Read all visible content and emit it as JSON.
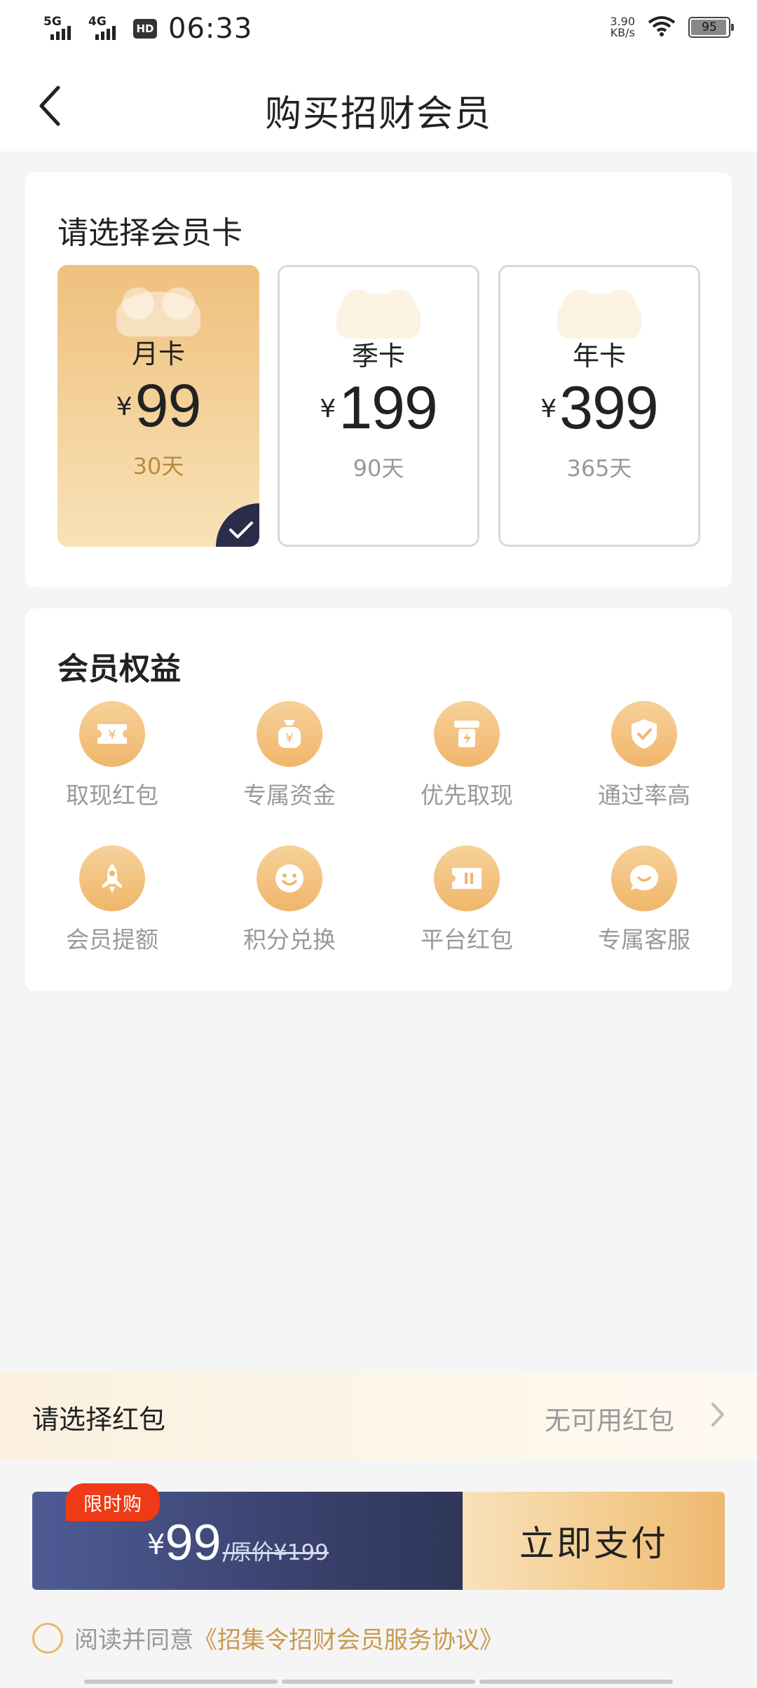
{
  "status_bar": {
    "network1": "5G",
    "network2": "4G",
    "hd": "HD",
    "time": "06:33",
    "speed_value": "3.90",
    "speed_unit": "KB/s",
    "battery": "95"
  },
  "header": {
    "title": "购买招财会员"
  },
  "plans": {
    "section_title": "请选择会员卡",
    "currency": "¥",
    "items": [
      {
        "name": "月卡",
        "price": "99",
        "days": "30天",
        "selected": true
      },
      {
        "name": "季卡",
        "price": "199",
        "days": "90天",
        "selected": false
      },
      {
        "name": "年卡",
        "price": "399",
        "days": "365天",
        "selected": false
      }
    ]
  },
  "benefits": {
    "section_title": "会员权益",
    "items": [
      {
        "label": "取现红包",
        "icon": "ticket-yen-icon"
      },
      {
        "label": "专属资金",
        "icon": "money-bag-icon"
      },
      {
        "label": "优先取现",
        "icon": "withdraw-icon"
      },
      {
        "label": "通过率高",
        "icon": "shield-check-icon"
      },
      {
        "label": "会员提额",
        "icon": "rocket-icon"
      },
      {
        "label": "积分兑换",
        "icon": "smiley-icon"
      },
      {
        "label": "平台红包",
        "icon": "coupon-icon"
      },
      {
        "label": "专属客服",
        "icon": "chat-icon"
      }
    ]
  },
  "red_packet": {
    "label": "请选择红包",
    "value": "无可用红包"
  },
  "pay_bar": {
    "promo_tag": "限时购",
    "currency": "¥",
    "price": "99",
    "original_prefix": "/原价",
    "original_price": "¥199",
    "button_label": "立即支付"
  },
  "agreement": {
    "text": "阅读并同意",
    "link": "《招集令招财会员服务协议》"
  },
  "colors": {
    "gold_start": "#efc07e",
    "gold_end": "#f8e2b8",
    "navy": "#3a426e",
    "promo_red": "#ee3a16",
    "link_gold": "#c99a4e"
  }
}
